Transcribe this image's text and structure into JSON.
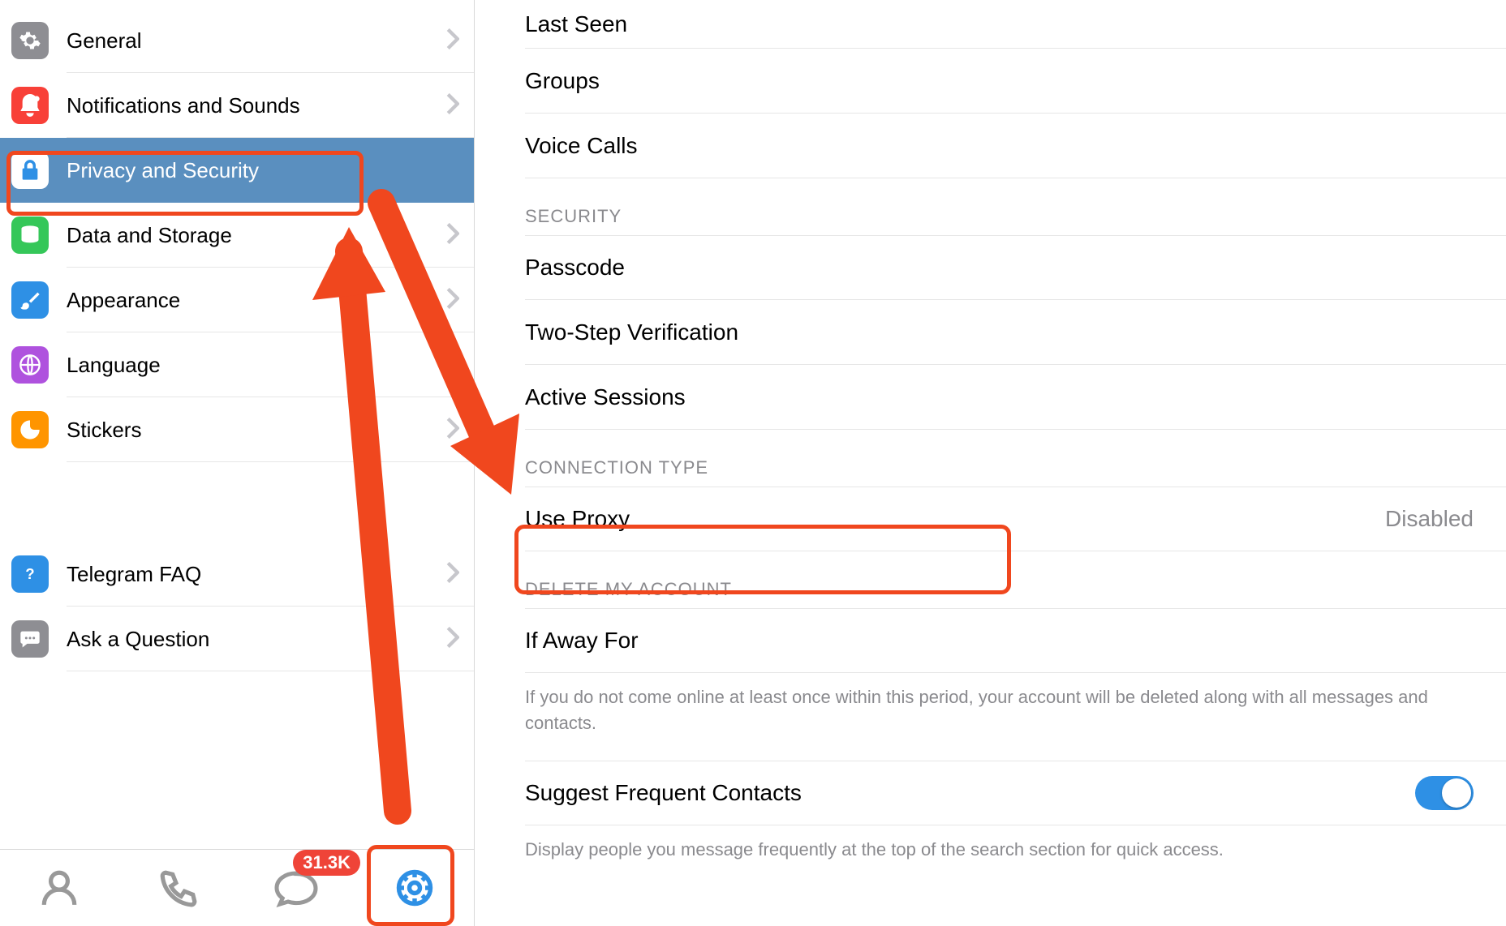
{
  "sidebar": {
    "items": [
      {
        "id": "general",
        "label": "General",
        "icon": "gear",
        "color": "#8e8e93"
      },
      {
        "id": "notifications",
        "label": "Notifications and Sounds",
        "icon": "bell",
        "color": "#f84038"
      },
      {
        "id": "privacy",
        "label": "Privacy and Security",
        "icon": "lock",
        "color": "#2e90e5",
        "selected": true
      },
      {
        "id": "data",
        "label": "Data and Storage",
        "icon": "stack",
        "color": "#35c759"
      },
      {
        "id": "appearance",
        "label": "Appearance",
        "icon": "brush",
        "color": "#2e90e5"
      },
      {
        "id": "language",
        "label": "Language",
        "icon": "globe",
        "color": "#af52de"
      },
      {
        "id": "stickers",
        "label": "Stickers",
        "icon": "sticker",
        "color": "#ff9500"
      }
    ],
    "help": [
      {
        "id": "faq",
        "label": "Telegram FAQ",
        "icon": "help",
        "color": "#2e90e5"
      },
      {
        "id": "ask",
        "label": "Ask a Question",
        "icon": "speech",
        "color": "#8e8e93"
      }
    ]
  },
  "tabbar": {
    "items": [
      {
        "id": "contacts",
        "icon": "contacts"
      },
      {
        "id": "calls",
        "icon": "calls"
      },
      {
        "id": "chats",
        "icon": "chats",
        "badge": "31.3K"
      },
      {
        "id": "settings",
        "icon": "settings",
        "active": true
      }
    ]
  },
  "content": {
    "privacy_rows": [
      {
        "label": "Last Seen"
      },
      {
        "label": "Groups"
      },
      {
        "label": "Voice Calls"
      }
    ],
    "security_header": "Security",
    "security_rows": [
      {
        "label": "Passcode"
      },
      {
        "label": "Two-Step Verification"
      },
      {
        "label": "Active Sessions"
      }
    ],
    "connection_header": "Connection Type",
    "connection_rows": [
      {
        "label": "Use Proxy",
        "value": "Disabled"
      }
    ],
    "delete_header": "Delete My Account",
    "delete_rows": [
      {
        "label": "If Away For"
      }
    ],
    "delete_footnote": "If you do not come online at least once within this period, your account will be deleted along with all messages and contacts.",
    "suggest_row": {
      "label": "Suggest Frequent Contacts",
      "toggle": true
    },
    "suggest_footnote": "Display people you message frequently at the top of the search section for quick access."
  },
  "annotations": {
    "highlight_privacy": true,
    "highlight_proxy": true,
    "highlight_gear": true,
    "arrow_to_privacy": true,
    "arrow_to_proxy": true
  }
}
